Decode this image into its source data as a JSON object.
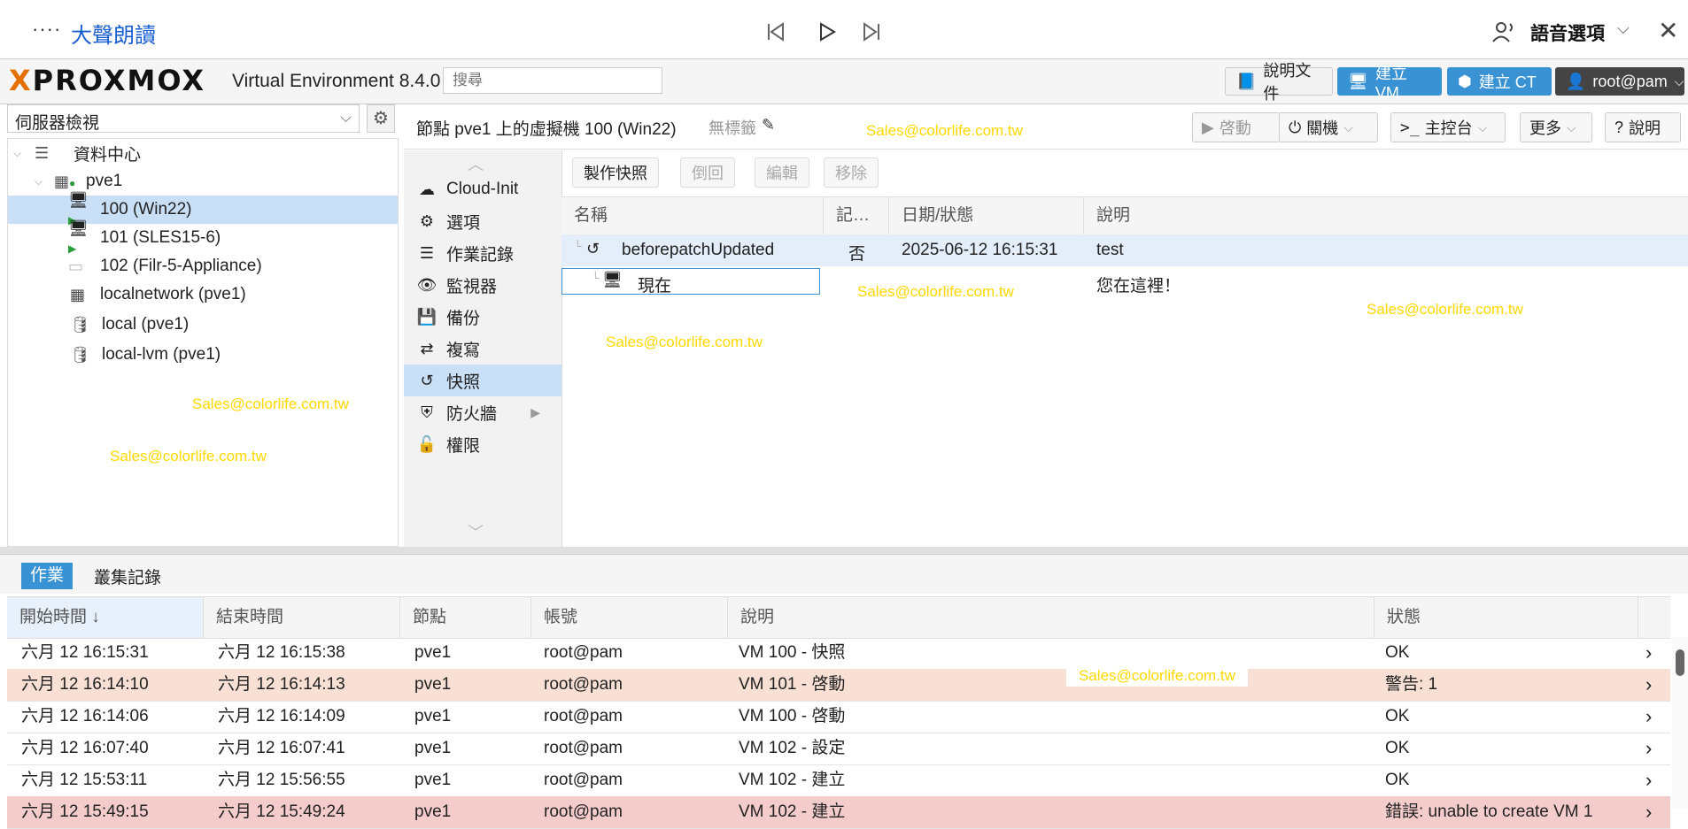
{
  "reader": {
    "dots": "····",
    "title": "大聲朗讀",
    "voice_options": "語音選項"
  },
  "header": {
    "logo_text": "PROXMOX",
    "version": "Virtual Environment 8.4.0",
    "search_placeholder": "搜尋",
    "docs_label": "說明文件",
    "create_vm_label": "建立 VM",
    "create_ct_label": "建立 CT",
    "user_label": "root@pam"
  },
  "tree": {
    "view_label": "伺服器檢視",
    "items": [
      {
        "label": "資料中心"
      },
      {
        "label": "pve1"
      },
      {
        "label": "100 (Win22)"
      },
      {
        "label": "101 (SLES15-6)"
      },
      {
        "label": "102 (Filr-5-Appliance)"
      },
      {
        "label": "localnetwork (pve1)"
      },
      {
        "label": "local (pve1)"
      },
      {
        "label": "local-lvm (pve1)"
      }
    ]
  },
  "panel": {
    "title": "節點 pve1 上的虛擬機 100 (Win22)",
    "tags_label": "無標籤",
    "start_label": "啓動",
    "shutdown_label": "關機",
    "console_label": "主控台",
    "more_label": "更多",
    "help_label": "說明"
  },
  "submenu": {
    "items": [
      {
        "label": "Cloud-Init"
      },
      {
        "label": "選項"
      },
      {
        "label": "作業記錄"
      },
      {
        "label": "監視器"
      },
      {
        "label": "備份"
      },
      {
        "label": "複寫"
      },
      {
        "label": "快照"
      },
      {
        "label": "防火牆"
      },
      {
        "label": "權限"
      }
    ]
  },
  "snapshot": {
    "buttons": {
      "take": "製作快照",
      "rollback": "倒回",
      "edit": "編輯",
      "remove": "移除"
    },
    "columns": {
      "name": "名稱",
      "ram": "記…",
      "date": "日期/狀態",
      "desc": "說明"
    },
    "rows": [
      {
        "name": "beforepatchUpdated",
        "ram": "否",
        "date": "2025-06-12 16:15:31",
        "desc": "test"
      },
      {
        "name": "現在",
        "ram": "",
        "date": "",
        "desc": "您在這裡！"
      }
    ]
  },
  "tasks": {
    "tab_tasks": "作業",
    "tab_cluster_log": "叢集記錄",
    "columns": {
      "start": "開始時間",
      "end": "結束時間",
      "node": "節點",
      "user": "帳號",
      "desc": "說明",
      "status": "狀態"
    },
    "rows": [
      {
        "start": "六月 12 16:15:31",
        "end": "六月 12 16:15:38",
        "node": "pve1",
        "user": "root@pam",
        "desc": "VM 100 - 快照",
        "status": "OK"
      },
      {
        "start": "六月 12 16:14:10",
        "end": "六月 12 16:14:13",
        "node": "pve1",
        "user": "root@pam",
        "desc": "VM 101 - 啓動",
        "status": "警告: 1"
      },
      {
        "start": "六月 12 16:14:06",
        "end": "六月 12 16:14:09",
        "node": "pve1",
        "user": "root@pam",
        "desc": "VM 100 - 啓動",
        "status": "OK"
      },
      {
        "start": "六月 12 16:07:40",
        "end": "六月 12 16:07:41",
        "node": "pve1",
        "user": "root@pam",
        "desc": "VM 102 - 設定",
        "status": "OK"
      },
      {
        "start": "六月 12 15:53:11",
        "end": "六月 12 15:56:55",
        "node": "pve1",
        "user": "root@pam",
        "desc": "VM 102 - 建立",
        "status": "OK"
      },
      {
        "start": "六月 12 15:49:15",
        "end": "六月 12 15:49:24",
        "node": "pve1",
        "user": "root@pam",
        "desc": "VM 102 - 建立",
        "status": "錯誤: unable to create VM 1"
      }
    ]
  },
  "watermark": "Sales@colorlife.com.tw",
  "colors": {
    "accent": "#3892d4",
    "selected": "#c8dff6",
    "warning_row": "#f8e1d4",
    "error_row": "#f5cccc",
    "logo_orange": "#e57000"
  }
}
